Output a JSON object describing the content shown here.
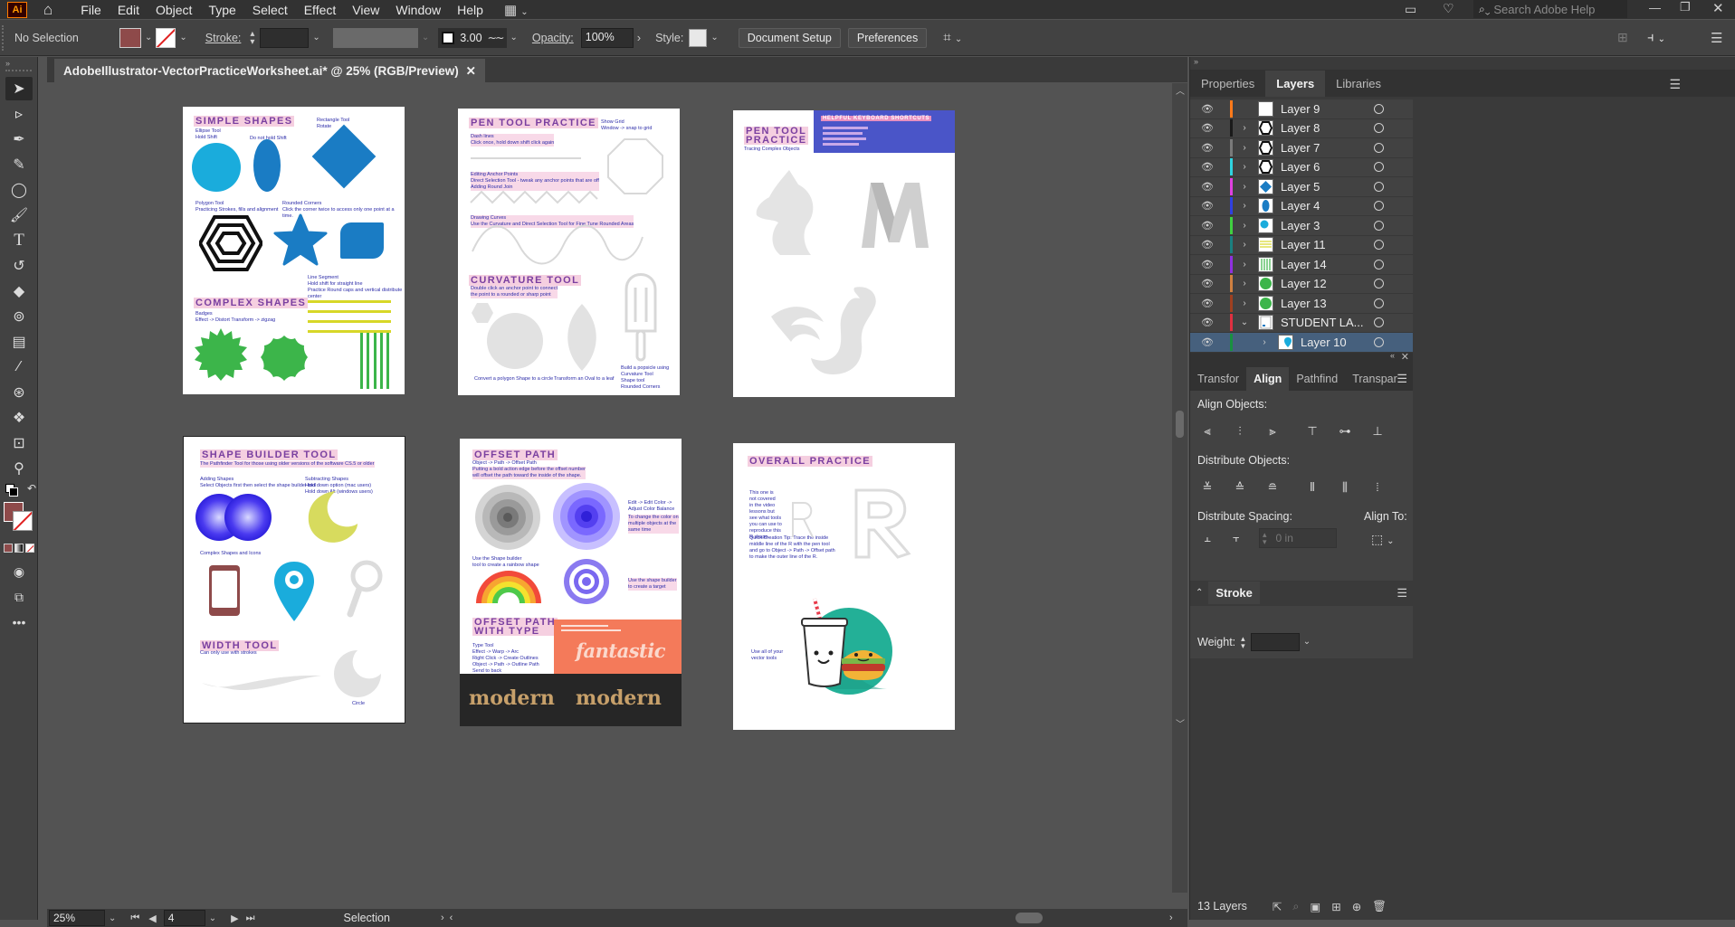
{
  "app": {
    "logo": "Ai",
    "title": "Adobe Illustrator"
  },
  "menubar": {
    "items": [
      "File",
      "Edit",
      "Object",
      "Type",
      "Select",
      "Effect",
      "View",
      "Window",
      "Help"
    ],
    "search_placeholder": "Search Adobe Help"
  },
  "controlbar": {
    "selection_label": "No Selection",
    "stroke_label": "Stroke:",
    "brush_size": "3.00",
    "opacity_label": "Opacity:",
    "opacity_value": "100%",
    "style_label": "Style:",
    "document_setup": "Document Setup",
    "preferences": "Preferences"
  },
  "document": {
    "tab_title": "AdobeIllustrator-VectorPracticeWorksheet.ai* @ 25% (RGB/Preview)"
  },
  "status": {
    "zoom": "25%",
    "artboard_number": "4",
    "tool": "Selection"
  },
  "panels": {
    "top_tabs": [
      "Properties",
      "Layers",
      "Libraries"
    ],
    "active_top_tab": "Layers",
    "layers": [
      {
        "name": "Layer 9",
        "color": "#ff7a1a",
        "expandable": false,
        "thumb": "blank"
      },
      {
        "name": "Layer 8",
        "color": "#1a1a1a",
        "expandable": true,
        "thumb": "hex"
      },
      {
        "name": "Layer 7",
        "color": "#7a7a7a",
        "expandable": true,
        "thumb": "hex"
      },
      {
        "name": "Layer 6",
        "color": "#2fd3e0",
        "expandable": true,
        "thumb": "hex"
      },
      {
        "name": "Layer 5",
        "color": "#e040e0",
        "expandable": true,
        "thumb": "diamond"
      },
      {
        "name": "Layer 4",
        "color": "#3040e0",
        "expandable": true,
        "thumb": "oval"
      },
      {
        "name": "Layer 3",
        "color": "#40d040",
        "expandable": true,
        "thumb": "circle"
      },
      {
        "name": "Layer 11",
        "color": "#1a8080",
        "expandable": true,
        "thumb": "lines"
      },
      {
        "name": "Layer 14",
        "color": "#9030e0",
        "expandable": true,
        "thumb": "vlines"
      },
      {
        "name": "Layer 12",
        "color": "#d08040",
        "expandable": true,
        "thumb": "green"
      },
      {
        "name": "Layer 13",
        "color": "#a04020",
        "expandable": true,
        "thumb": "green"
      },
      {
        "name": "STUDENT LA...",
        "color": "#e03040",
        "expandable": true,
        "thumb": "doc"
      },
      {
        "name": "Layer 10",
        "color": "#1a9040",
        "expandable": true,
        "thumb": "pin",
        "selected": true
      }
    ],
    "mid_tabs": [
      "Transfor",
      "Align",
      "Pathfind",
      "Transpar"
    ],
    "active_mid_tab": "Align",
    "align_objects_label": "Align Objects:",
    "distribute_objects_label": "Distribute Objects:",
    "distribute_spacing_label": "Distribute Spacing:",
    "align_to_label": "Align To:",
    "spacing_value": "0 in",
    "stroke_title": "Stroke",
    "weight_label": "Weight:",
    "layer_count": "13 Layers"
  },
  "artboards": {
    "a1": {
      "title": "SIMPLE SHAPES",
      "notes": [
        "Ellipse Tool\nHold Shift",
        "Do not hold Shift",
        "Rectangle Tool\nRotate",
        "Polygon Tool\nPracticing Strokes, fills and alignment",
        "Rounded Corners\nClick the corner twice to access only one point at a time.",
        "Line Segment\nHold shift for straight line\nPractice Round caps and vertical distribute center",
        "Badges\nEffect -> Distort Transform -> zigzag"
      ],
      "subtitle": "COMPLEX SHAPES"
    },
    "a2": {
      "title": "PEN TOOL PRACTICE",
      "notes": [
        "Show Grid\nWindow -> snap to grid",
        "Dash lines\nClick once, hold down shift click again",
        "Editing Anchor Points\nDirect Selection Tool - tweak any anchor points that are off\nAdding Round Join",
        "Drawing Curves\nUse the Curvature and Direct Selection Tool for Fine Tune Rounded Areas",
        "Double click an anchor point to connect the point to a rounded or sharp point",
        "Convert a polygon Shape to a circle",
        "Transform an Oval to a leaf",
        "Build a popsicle using\nCurvature Tool\nShape tool\nRounded Corners"
      ],
      "subtitle": "CURVATURE TOOL"
    },
    "a3": {
      "title": "PEN TOOL\nPRACTICE",
      "note": "Tracing Complex Objects",
      "box_title": "HELPFUL KEYBOARD SHORTCUTS"
    },
    "a4": {
      "title": "SHAPE BUILDER TOOL",
      "notes": [
        "The Pathfinder Tool for those using older versions of the software CS.5 or older",
        "Adding Shapes\nSelect Objects first then select the shape builder tool",
        "Subtracting Shapes\nHold down option (mac users)\nHold down Alt (windows users)",
        "Complex Shapes and Icons",
        "Can only use with strokes",
        "Circle"
      ],
      "subtitle": "WIDTH TOOL"
    },
    "a5": {
      "title": "OFFSET PATH",
      "notes": [
        "Object -> Path -> Offset Path",
        "Putting a bold action edge before the offset number\nwill offset the path toward the inside of the shape.",
        "Edit -> Edit Color ->\nAdjust Color Balance",
        "To change the color on\nmultiple objects at the\nsame time",
        "Use the Shape builder\ntool to create a rainbow shape",
        "Use the shape builder\nto create a target",
        "Type Tool\nEffect -> Warp -> Arc\nRight Click -> Create Outlines\nObject -> Path -> Outline Path\nSend to back"
      ],
      "subtitle": "OFFSET PATH\nWITH TYPE",
      "fantastic": "fantastic",
      "modern1": "modern",
      "modern2": "modern"
    },
    "a6": {
      "title": "OVERALL PRACTICE",
      "notes": [
        "This one is\nnot covered\nin the video\nlessons but\nsee what tools\nyou can use to\nreproduce this\nR shape.",
        "Quick Creation Tip: Trace the inside\nmiddle line of the R with the pen tool\nand go to Object -> Path -> Offset path\nto make the outer line of the R.",
        "Use all of your\nvector tools"
      ]
    }
  },
  "colors": {
    "accent_blue": "#1a7cc4",
    "shape_cyan": "#1aacdc",
    "green": "#3cb54a",
    "fill_swatch": "#8e4a4a"
  }
}
